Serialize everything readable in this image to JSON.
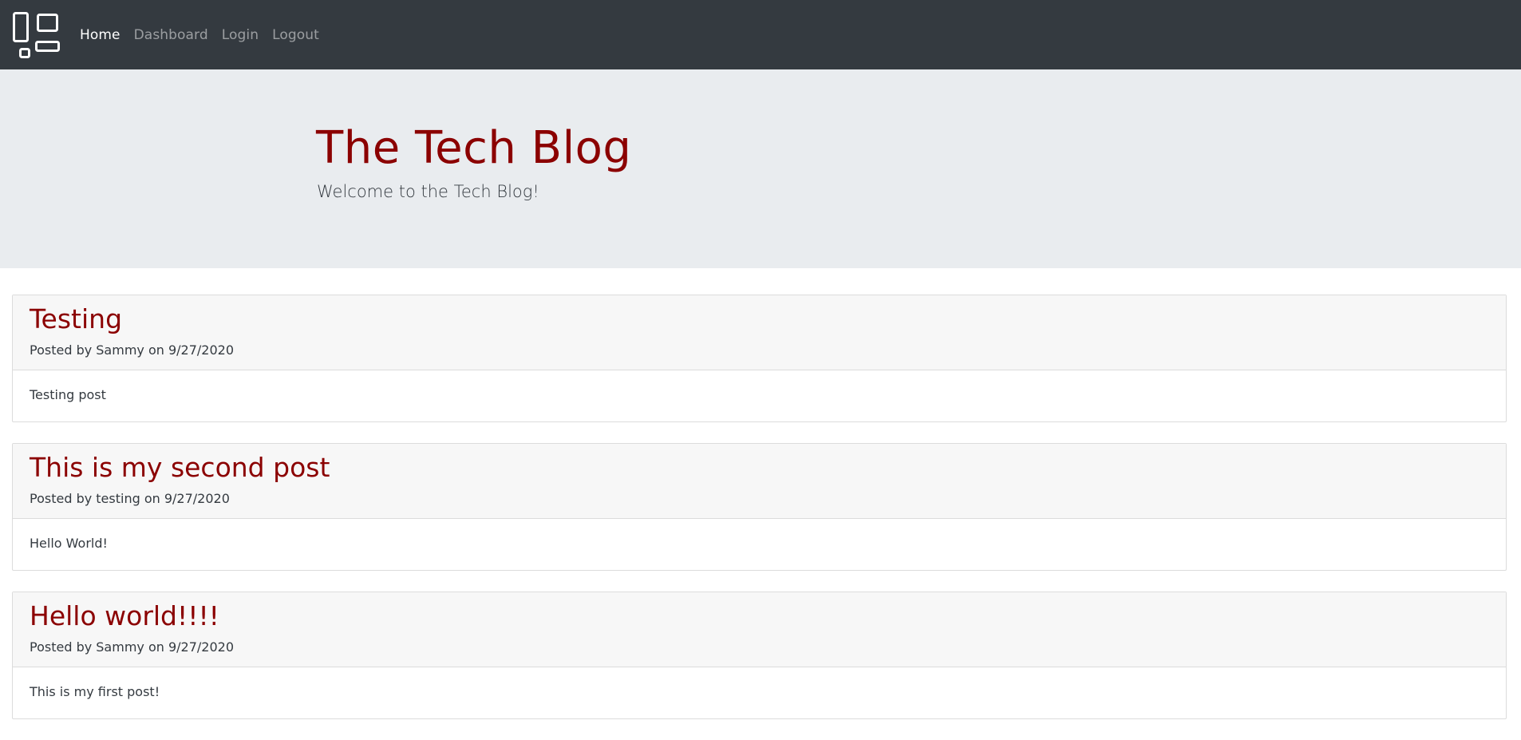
{
  "nav": {
    "logo_icon": "dashboard-layout-icon",
    "links": [
      {
        "label": "Home",
        "active": true
      },
      {
        "label": "Dashboard",
        "active": false
      },
      {
        "label": "Login",
        "active": false
      },
      {
        "label": "Logout",
        "active": false
      }
    ]
  },
  "hero": {
    "title": "The Tech Blog",
    "subtitle": "Welcome to the Tech Blog!"
  },
  "posts": [
    {
      "title": "Testing",
      "meta": "Posted by Sammy on 9/27/2020",
      "content": "Testing post"
    },
    {
      "title": "This is my second post",
      "meta": "Posted by testing on 9/27/2020",
      "content": "Hello World!"
    },
    {
      "title": "Hello world!!!!",
      "meta": "Posted by Sammy on 9/27/2020",
      "content": "This is my first post!"
    }
  ],
  "colors": {
    "navbar_bg": "#343a40",
    "jumbotron_bg": "#e9ecef",
    "accent": "#8b0000",
    "text": "#343a40"
  }
}
